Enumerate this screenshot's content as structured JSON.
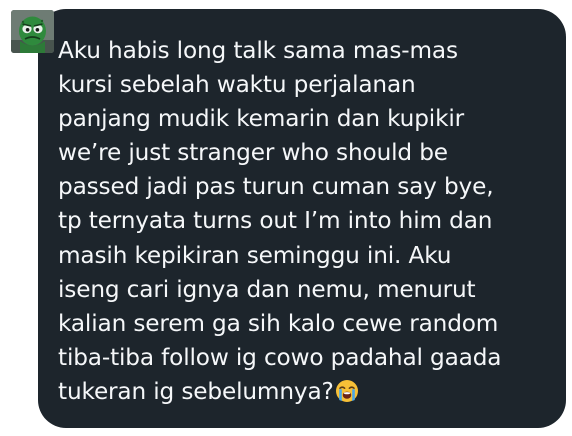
{
  "sender": {
    "avatar_icon": "green-creature-avatar-icon"
  },
  "message": {
    "text": "Aku habis long talk sama mas-mas\nkursi sebelah waktu perjalanan\npanjang mudik kemarin dan kupikir\nwe’re just stranger who should be\npassed jadi pas turun cuman say bye,\ntp ternyata turns out I’m into him dan\nmasih kepikiran seminggu ini. Aku\niseng cari ignya dan nemu, menurut\nkalian serem ga sih kalo cewe random\ntiba-tiba follow ig cowo padahal gaada\ntukeran ig sebelumnya?",
    "emoji": "loudly-crying-face-icon"
  },
  "colors": {
    "bubble": "#1d252c",
    "text": "#f5f7f9",
    "background": "#ffffff"
  }
}
